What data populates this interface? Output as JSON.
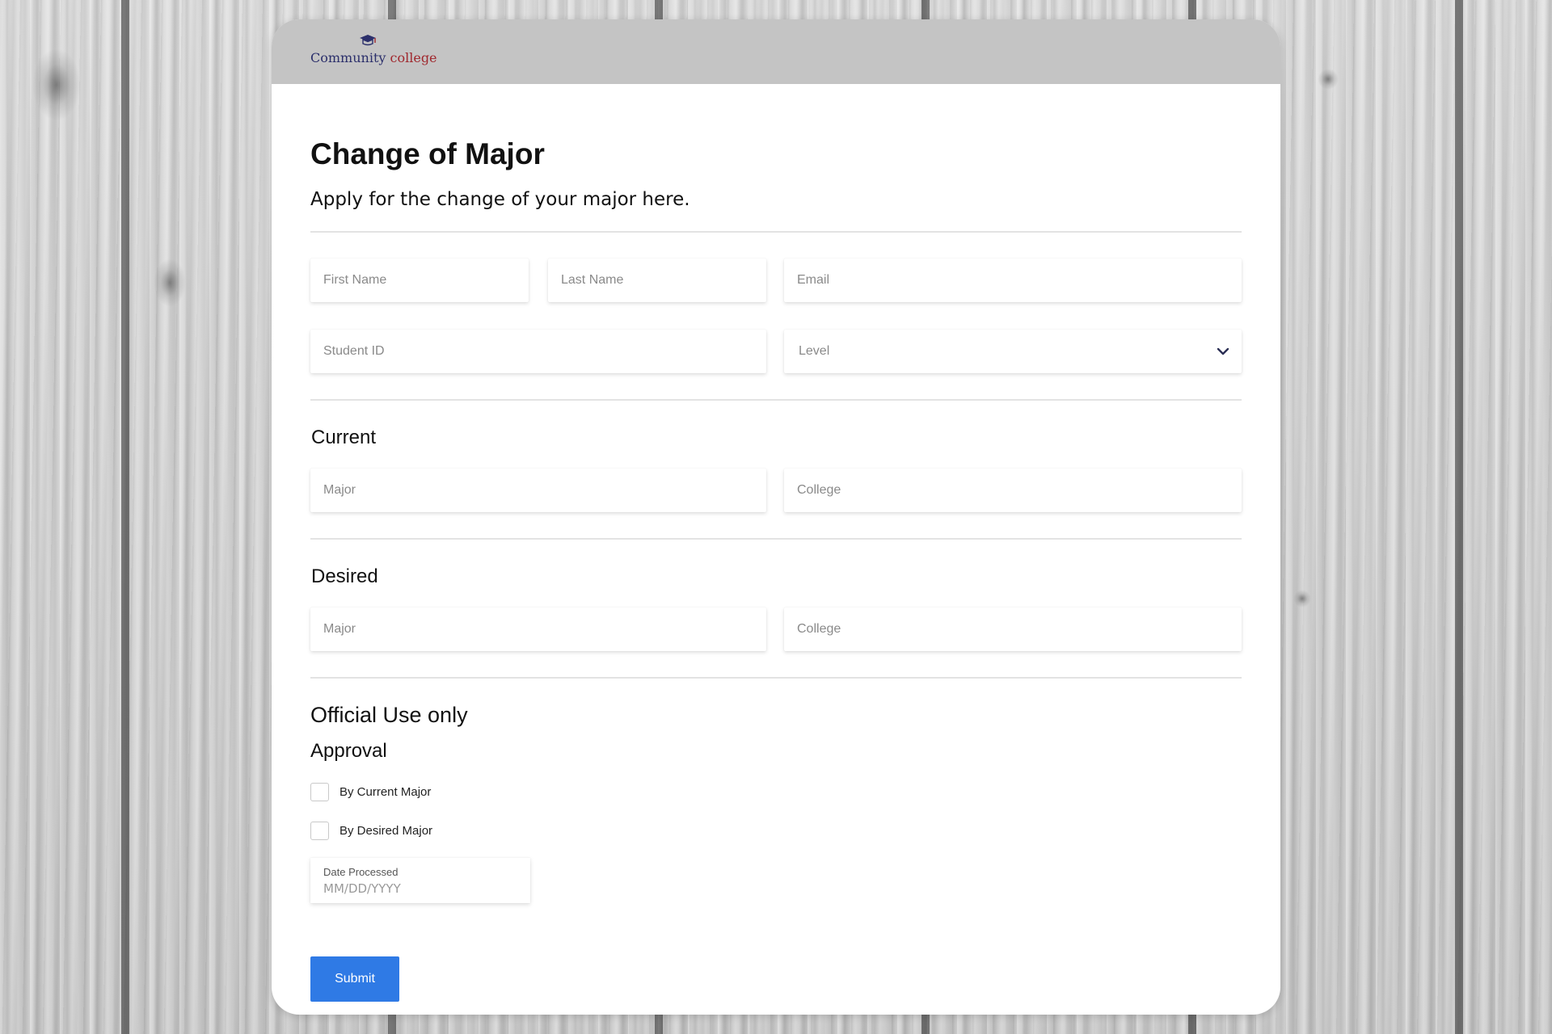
{
  "brand": {
    "logo_word1": "Community",
    "logo_word2": "college"
  },
  "form": {
    "title": "Change of Major",
    "subtitle": "Apply for the change of your major here.",
    "first_name_placeholder": "First Name",
    "last_name_placeholder": "Last Name",
    "email_placeholder": "Email",
    "student_id_placeholder": "Student ID",
    "level_placeholder": "Level"
  },
  "current": {
    "heading": "Current",
    "major_placeholder": "Major",
    "college_placeholder": "College"
  },
  "desired": {
    "heading": "Desired",
    "major_placeholder": "Major",
    "college_placeholder": "College"
  },
  "official": {
    "heading": "Official Use only",
    "approval_heading": "Approval",
    "checkbox_current": "By Current Major",
    "checkbox_desired": "By Desired Major",
    "date_label": "Date Processed",
    "date_placeholder": "MM/DD/YYYY"
  },
  "submit_label": "Submit",
  "colors": {
    "header_bar": "#c4c4c4",
    "submit_button": "#2f7ae5",
    "logo_word1": "#2b2f6b",
    "logo_word2": "#a0282e"
  }
}
